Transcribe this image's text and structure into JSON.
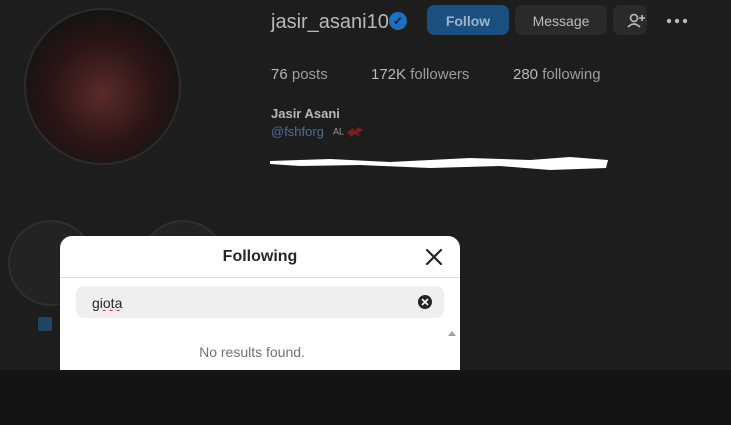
{
  "profile": {
    "username": "jasir_asani10",
    "follow_label": "Follow",
    "message_label": "Message",
    "stats": {
      "posts_count": "76",
      "posts_label": "posts",
      "followers_count": "172K",
      "followers_label": "followers",
      "following_count": "280",
      "following_label": "following"
    },
    "full_name": "Jasir Asani",
    "handle": "@fshforg",
    "handle_badge": "AL"
  },
  "modal": {
    "title": "Following",
    "search_value": "giota",
    "empty_text": "No results found."
  },
  "colors": {
    "accent": "#1b4f7f",
    "link": "#4a6f99",
    "modal_bg": "#ffffff"
  }
}
